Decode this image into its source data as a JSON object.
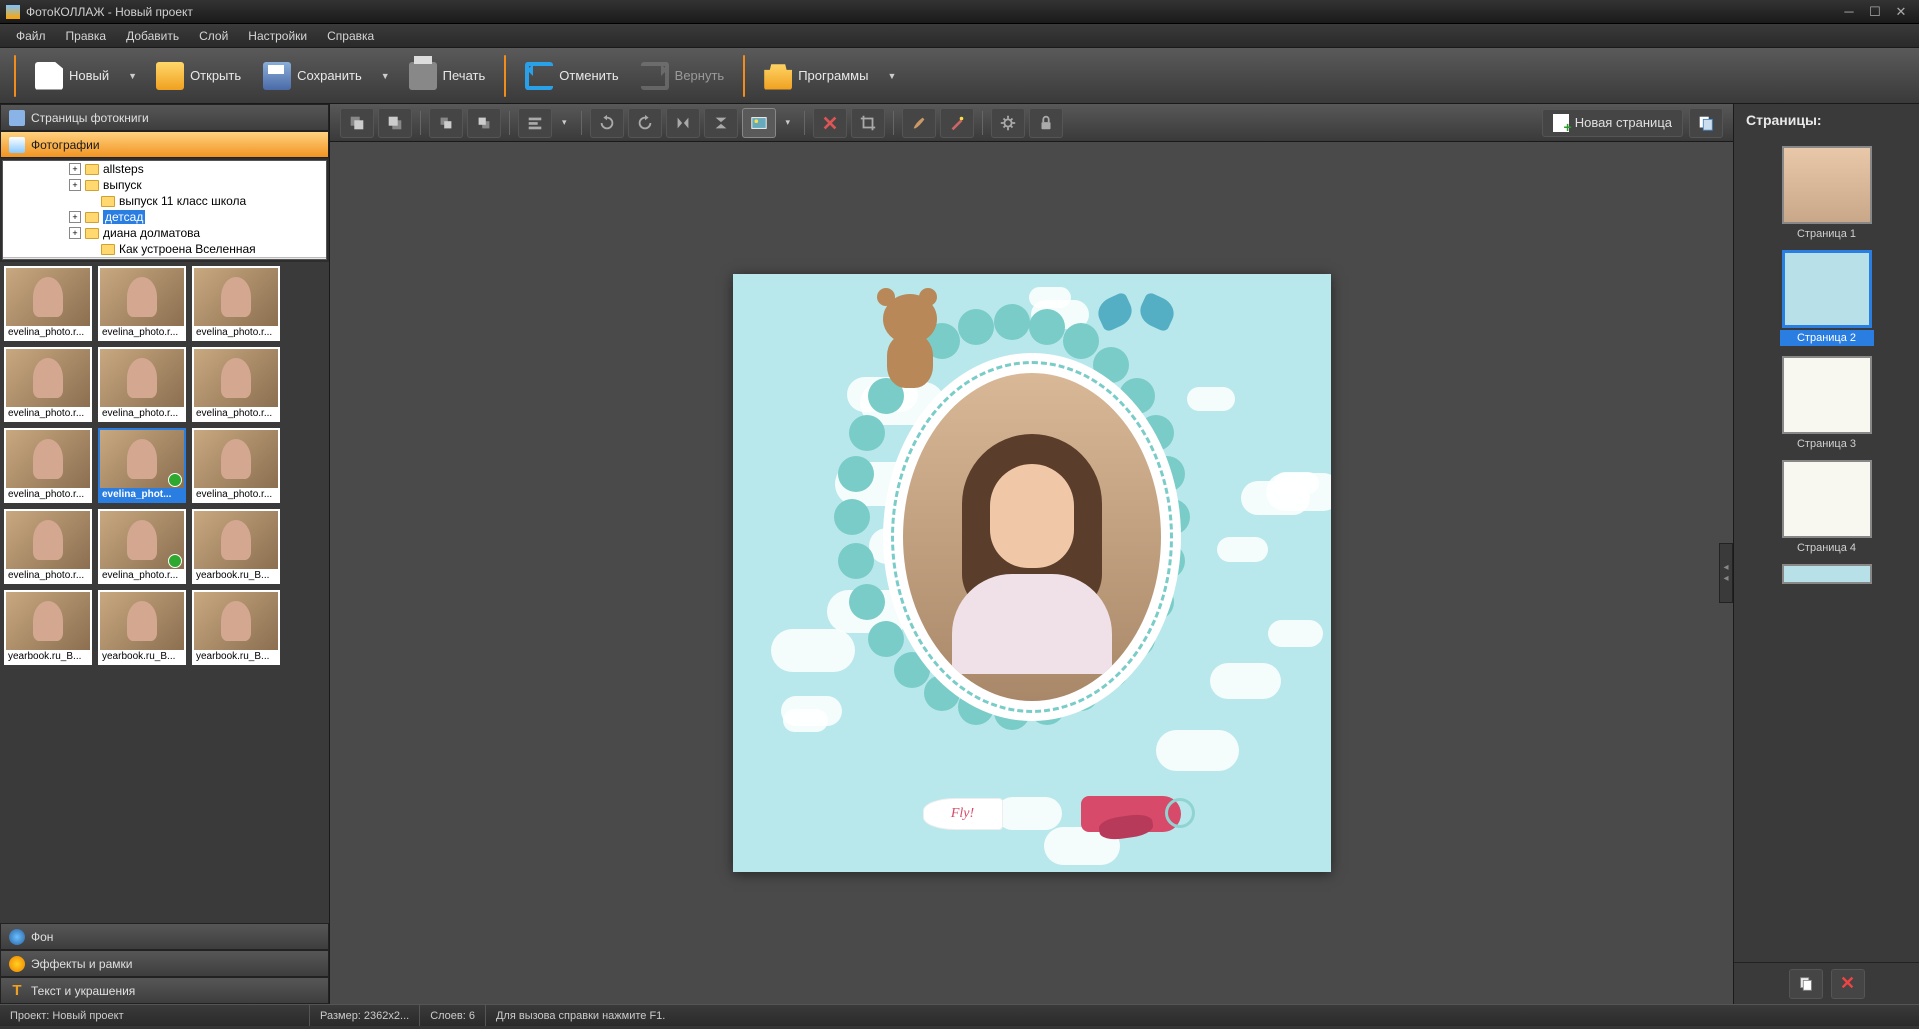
{
  "title": "ФотоКОЛЛАЖ - Новый проект",
  "menu": [
    "Файл",
    "Правка",
    "Добавить",
    "Слой",
    "Настройки",
    "Справка"
  ],
  "toolbar": {
    "new": "Новый",
    "open": "Открыть",
    "save": "Сохранить",
    "print": "Печать",
    "undo": "Отменить",
    "redo": "Вернуть",
    "programs": "Программы"
  },
  "left": {
    "tabs": {
      "pages": "Страницы фотокниги",
      "photos": "Фотографии",
      "bg": "Фон",
      "effects": "Эффекты и рамки",
      "text": "Текст и украшения"
    },
    "tree": [
      {
        "indent": 60,
        "plus": true,
        "label": "allsteps"
      },
      {
        "indent": 60,
        "plus": true,
        "label": "выпуск"
      },
      {
        "indent": 76,
        "plus": false,
        "label": "выпуск 11 класс школа"
      },
      {
        "indent": 60,
        "plus": true,
        "label": "детсад",
        "selected": true
      },
      {
        "indent": 60,
        "plus": true,
        "label": "диана долматова"
      },
      {
        "indent": 76,
        "plus": false,
        "label": "Как устроена Вселенная"
      }
    ],
    "photos": [
      [
        "evelina_photo.r...",
        "evelina_photo.r...",
        "evelina_photo.r..."
      ],
      [
        "evelina_photo.r...",
        "evelina_photo.r...",
        "evelina_photo.r..."
      ],
      [
        "evelina_photo.r...",
        "evelina_phot...",
        "evelina_photo.r..."
      ],
      [
        "evelina_photo.r...",
        "evelina_photo.r...",
        "yearbook.ru_B..."
      ],
      [
        "yearbook.ru_B...",
        "yearbook.ru_B...",
        "yearbook.ru_B..."
      ]
    ],
    "selected_row": 2,
    "selected_col": 1,
    "checked": [
      [
        2,
        1
      ],
      [
        3,
        1
      ]
    ]
  },
  "center": {
    "new_page": "Новая страница",
    "banner_text": "Fly!"
  },
  "right": {
    "header": "Страницы:",
    "pages": [
      "Страница 1",
      "Страница 2",
      "Страница 3",
      "Страница 4"
    ],
    "selected": 1
  },
  "status": {
    "project": "Проект:  Новый проект",
    "size": "Размер:  2362x2...",
    "layers": "Слоев:   6",
    "help": "Для вызова справки нажмите F1."
  }
}
